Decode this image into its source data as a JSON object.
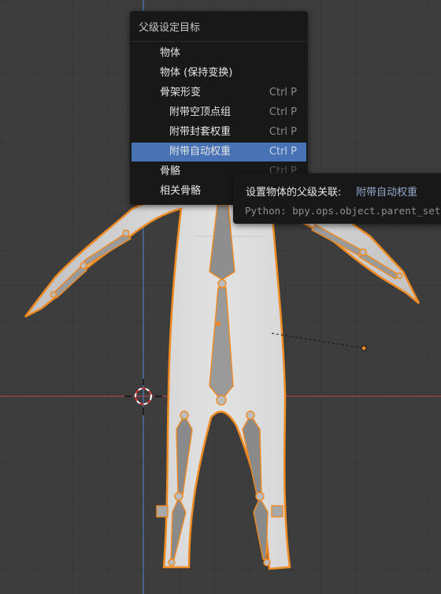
{
  "menu": {
    "title": "父级设定目标",
    "items": [
      {
        "label": "物体",
        "shortcut": ""
      },
      {
        "label": "物体 (保持变换)",
        "shortcut": ""
      },
      {
        "label": "骨架形变",
        "shortcut": "Ctrl P"
      },
      {
        "label": "附带空顶点组",
        "shortcut": "Ctrl P"
      },
      {
        "label": "附带封套权重",
        "shortcut": "Ctrl P"
      },
      {
        "label": "附带自动权重",
        "shortcut": "Ctrl P"
      },
      {
        "label": "骨骼",
        "shortcut": "Ctrl P"
      },
      {
        "label": "相关骨骼",
        "shortcut": ""
      }
    ],
    "active_index": 5
  },
  "tooltip": {
    "description": "设置物体的父级关联:",
    "value": "附带自动权重",
    "python": "Python: bpy.ops.object.parent_set(type='ARMATURE_AUTO')"
  },
  "colors": {
    "viewport_bg": "#3d3d3d",
    "grid": "#333333",
    "x_axis": "#a8404c",
    "y_axis": "#4d7cb5",
    "selection_outline": "#f08a22",
    "menu_bg": "#181818",
    "menu_highlight": "#4772b3",
    "mesh": "#d3d3d3",
    "bone": "#9a9a9a"
  },
  "icons": [
    "3d-cursor-icon",
    "light-object-icon"
  ]
}
